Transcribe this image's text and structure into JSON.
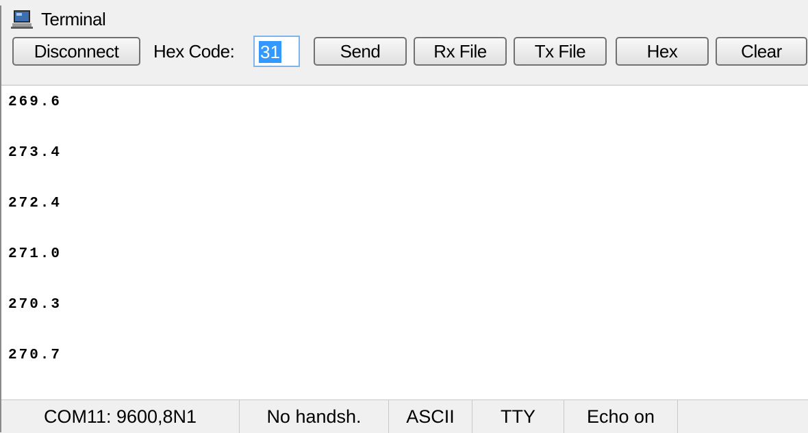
{
  "window": {
    "title": "Terminal",
    "icon": "computer-icon"
  },
  "toolbar": {
    "disconnect_label": "Disconnect",
    "hex_code_label": "Hex Code:",
    "hex_code_value": "31",
    "send_label": "Send",
    "rx_file_label": "Rx File",
    "tx_file_label": "Tx File",
    "hex_label": "Hex",
    "clear_label": "Clear"
  },
  "output": {
    "lines": [
      "269.6",
      "273.4",
      "272.4",
      "271.0",
      "270.3",
      "270.7"
    ]
  },
  "status_bar": {
    "port": "COM11: 9600,8N1",
    "handshake": "No handsh.",
    "mode": "ASCII",
    "terminal": "TTY",
    "echo": "Echo on"
  }
}
